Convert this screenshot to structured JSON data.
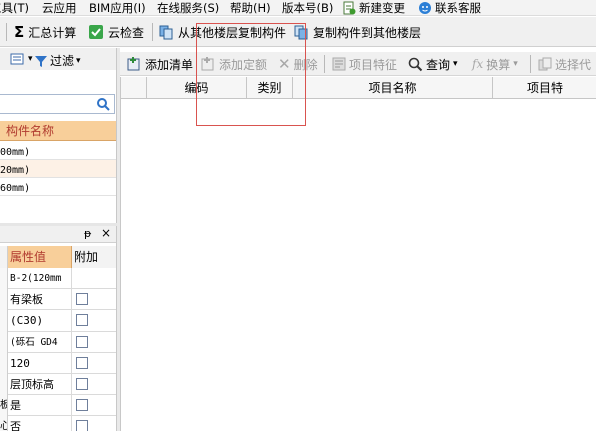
{
  "menu": [
    {
      "label": "工具(T)"
    },
    {
      "label": "云应用"
    },
    {
      "label": "BIM应用(I)"
    },
    {
      "label": "在线服务(S)"
    },
    {
      "label": "帮助(H)"
    },
    {
      "label": "版本号(B)"
    },
    {
      "label": "新建变更"
    },
    {
      "label": "联系客服"
    }
  ],
  "toolbar1": {
    "sum_calc": "汇总计算",
    "cloud_check": "云检查",
    "copy_from_other": "从其他楼层复制构件",
    "copy_to_other": "复制构件到其他楼层"
  },
  "left_top": {
    "filter_label": "过滤",
    "column_header": "构件名称",
    "rows": [
      "00mm)",
      "20mm)",
      "60mm)"
    ]
  },
  "left_bottom": {
    "headers": {
      "value": "属性值",
      "extra": "附加"
    },
    "rows": [
      {
        "left": "",
        "value": "B-2(120mm",
        "checkbox": false
      },
      {
        "left": "",
        "value": "有梁板",
        "checkbox": true
      },
      {
        "left": "",
        "value": "(C30)",
        "checkbox": true
      },
      {
        "left": "",
        "value": "(砾石 GD4",
        "checkbox": true
      },
      {
        "left": "",
        "value": "120",
        "checkbox": true
      },
      {
        "left": "",
        "value": "层顶标高",
        "checkbox": true
      },
      {
        "left": "板",
        "value": "是",
        "checkbox": true
      },
      {
        "left": "心",
        "value": "否",
        "checkbox": true
      }
    ]
  },
  "right_toolbar": {
    "add_list": "添加清单",
    "add_quota": "添加定额",
    "delete": "删除",
    "item_feature": "项目特征",
    "query": "查询",
    "convert": "换算",
    "select_code": "选择代"
  },
  "grid": {
    "headers": [
      "编码",
      "类别",
      "项目名称",
      "项目特"
    ]
  },
  "colors": {
    "accent_red": "#d9534f",
    "header_orange": "#f8cf9a"
  }
}
